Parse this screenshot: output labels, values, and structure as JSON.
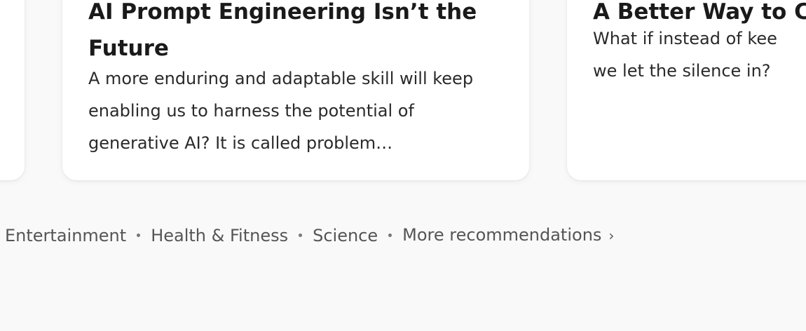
{
  "cards": {
    "main": {
      "title": "AI Prompt Engineering Isn’t the Future",
      "description": "A more enduring and adaptable skill will keep enabling us to harness the potential of generative AI? It is called problem…"
    },
    "right": {
      "title": "A Better Way to C",
      "description_line1": "What if instead of kee",
      "description_line2": "we let the silence in?"
    }
  },
  "topics": {
    "items": [
      "Entertainment",
      "Health & Fitness",
      "Science"
    ],
    "more_label": "More recommendations",
    "more_icon": "chevron-right-icon"
  }
}
